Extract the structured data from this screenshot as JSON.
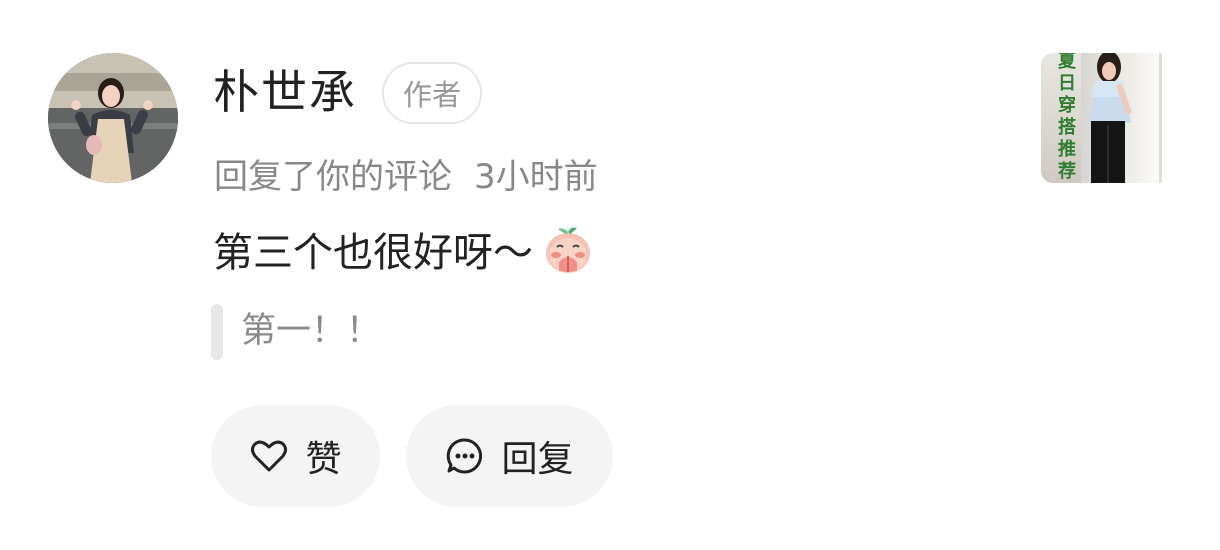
{
  "comment": {
    "username": "朴世承",
    "author_badge": "作者",
    "action_text": "回复了你的评论",
    "time_ago": "3小时前",
    "text": "第三个也很好呀～",
    "emoji_name": "praying-peach-emoji",
    "quoted_text": "第一！！"
  },
  "actions": {
    "like_label": "赞",
    "reply_label": "回复"
  },
  "thumbnail": {
    "caption": "夏日穿搭推荐"
  },
  "colors": {
    "primary_text": "#222222",
    "secondary_text": "#888888",
    "button_bg": "#f4f4f4",
    "badge_border": "#e6e6e6",
    "thumb_caption": "#2f7d2f"
  }
}
